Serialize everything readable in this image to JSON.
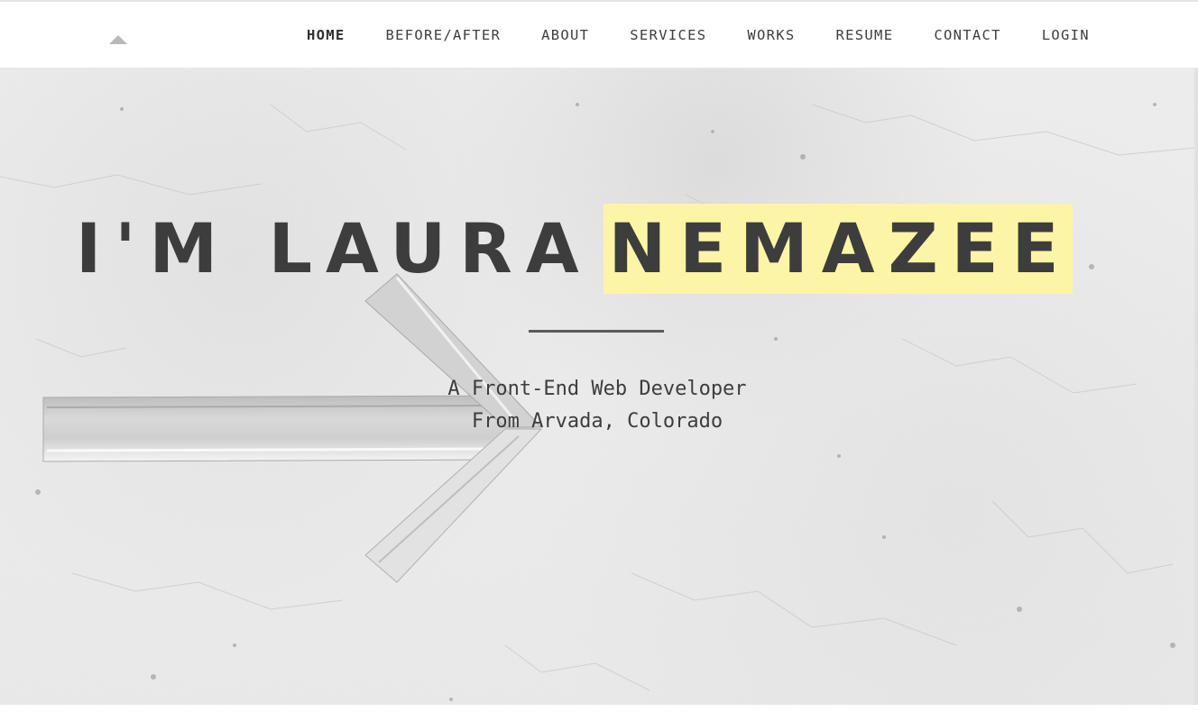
{
  "nav": {
    "items": [
      {
        "label": "HOME",
        "active": true
      },
      {
        "label": "BEFORE/AFTER",
        "active": false
      },
      {
        "label": "ABOUT",
        "active": false
      },
      {
        "label": "SERVICES",
        "active": false
      },
      {
        "label": "WORKS",
        "active": false
      },
      {
        "label": "RESUME",
        "active": false
      },
      {
        "label": "CONTACT",
        "active": false
      },
      {
        "label": "LOGIN",
        "active": false
      }
    ]
  },
  "logo": {
    "icon": "caret-up-icon"
  },
  "hero": {
    "title_first": "I'M LAURA",
    "title_last": "NEMAZEE",
    "tagline_line1": "A Front-End Web Developer",
    "tagline_line2": "From Arvada, Colorado",
    "background_icon": "arrow-right-icon"
  },
  "colors": {
    "highlight": "#fdf5a6",
    "text": "#3d3d3d",
    "divider": "#5b5b5b"
  }
}
